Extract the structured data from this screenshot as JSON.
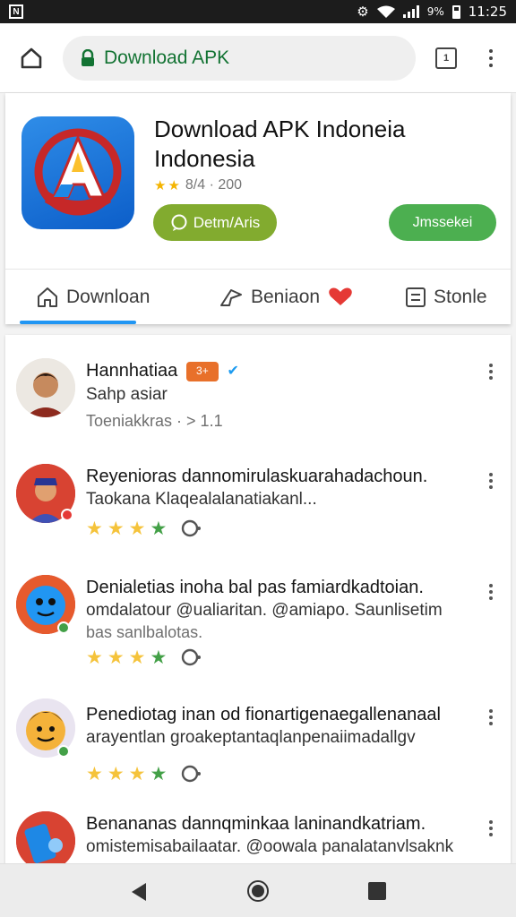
{
  "status_bar": {
    "notification_icon": "N",
    "icons": [
      "settings-icon",
      "wifi-icon",
      "signal-icon",
      "battery-icon"
    ],
    "battery_percent": "9%",
    "time": "11:25"
  },
  "browser": {
    "url_text": "Download APK",
    "tab_count": "1"
  },
  "app": {
    "title": "Download APK Indoneia Indonesia",
    "rating_text": "8/4 · 200",
    "stars_filled": 2,
    "btn_left_label": "Detm/Aris",
    "btn_right_label": "Jmssekei",
    "tabs": [
      {
        "label": "Downloan",
        "icon": "home-icon"
      },
      {
        "label": "Beniaon",
        "icon": "share-icon"
      },
      {
        "label": "Stonle",
        "icon": "list-icon"
      }
    ],
    "selected_tab": 0
  },
  "reviews": [
    {
      "name": "Hannhatiaa",
      "line2": "Sahp asiar",
      "line3": "Toeniakkras · > 1.1",
      "badge_text": "3+"
    },
    {
      "line1": "Reyenioras dannomirulaskuarahadachoun.",
      "line2": "Taokana Klaqealalanatiakanl...",
      "stars": 4,
      "status_color": "#e53935"
    },
    {
      "line1": "Denialetias inoha bal pas famiardkadtoian.",
      "line2": "omdalatour @ualiaritan. @amiapo. Saunlisetim",
      "line3": "bas sanlbalotas.",
      "stars": 4,
      "status_color": "#43a047"
    },
    {
      "line1": "Penediotag inan od fionartigenaegallenanaal",
      "line2": "arayentlan groakeptantaqlanpenaiimadallgv",
      "stars": 4,
      "status_color": "#43a047"
    },
    {
      "line1": "Benananas dannqminkaa laninandkatriam.",
      "line2": "omistemisabailaatar. @oowala panalatanvlsaknk"
    }
  ]
}
